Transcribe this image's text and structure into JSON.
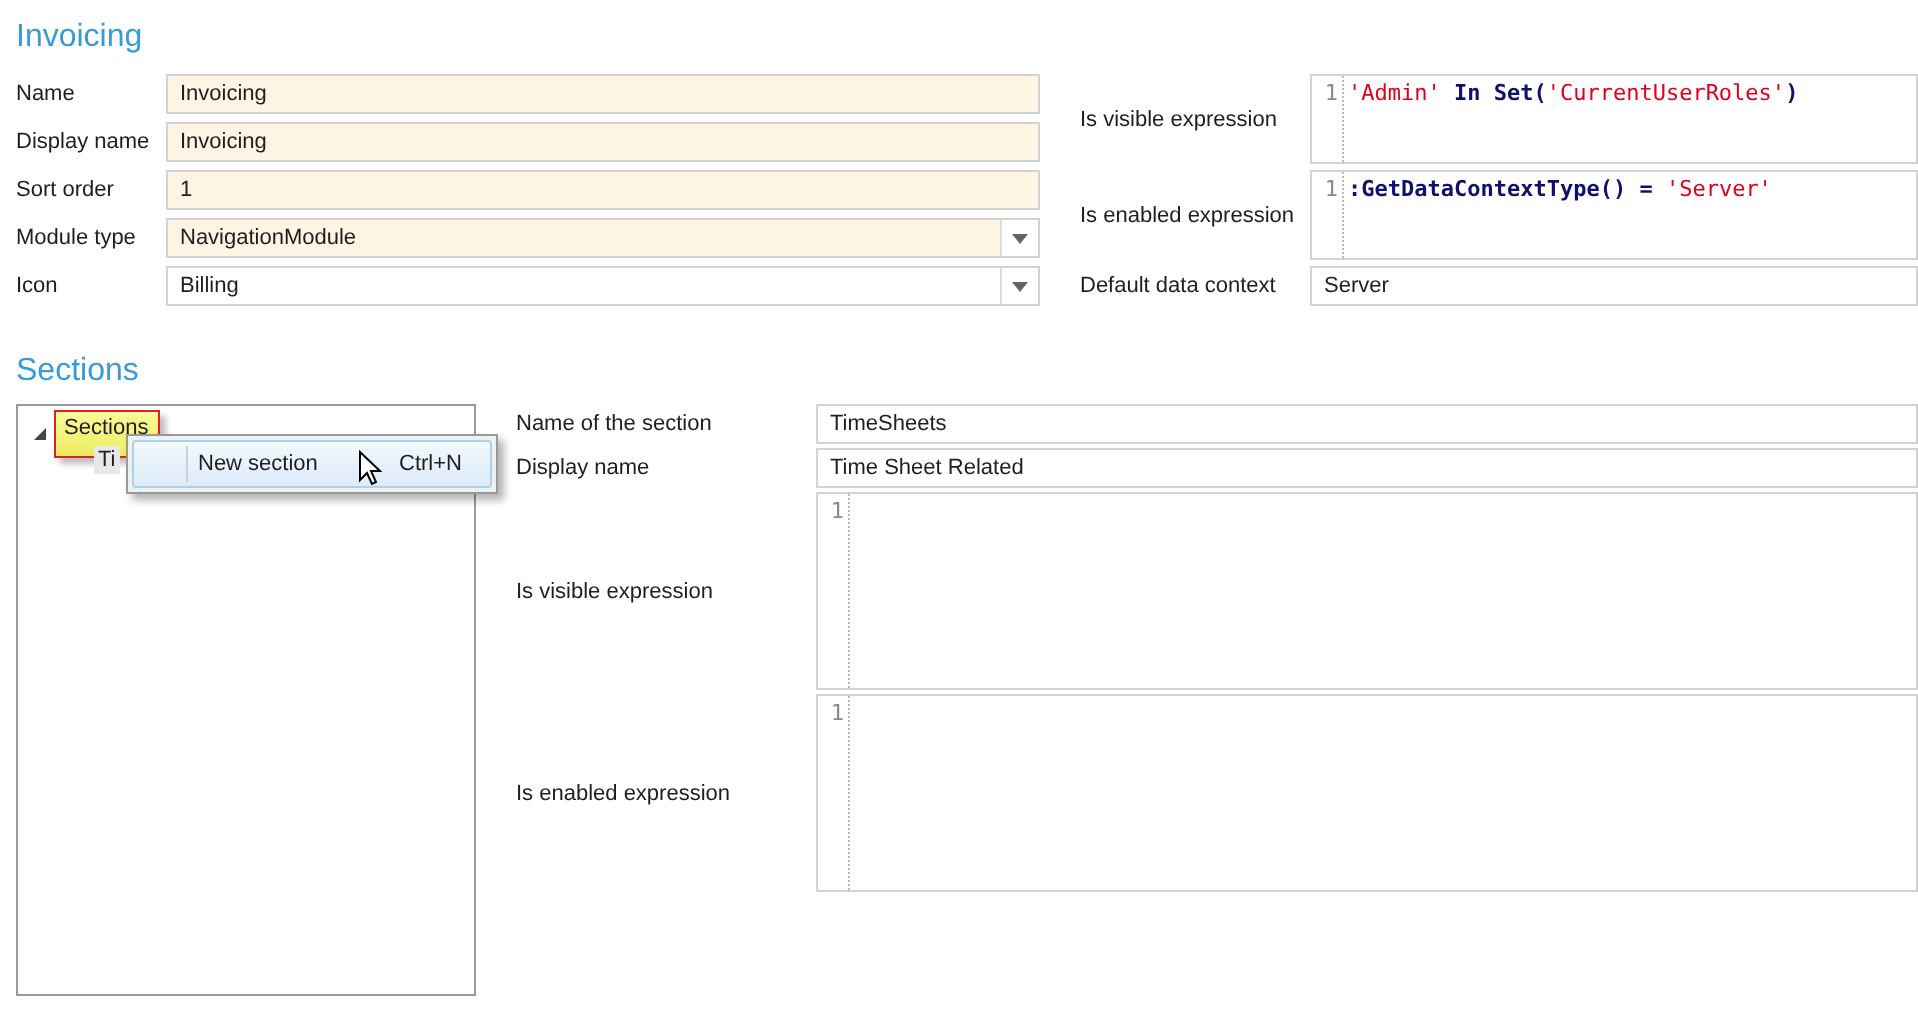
{
  "module": {
    "title": "Invoicing",
    "fields": [
      {
        "label": "Name",
        "value": "Invoicing",
        "kind": "text",
        "required": true
      },
      {
        "label": "Display name",
        "value": "Invoicing",
        "kind": "text",
        "required": true
      },
      {
        "label": "Sort order",
        "value": "1",
        "kind": "text",
        "required": true
      },
      {
        "label": "Module type",
        "value": "NavigationModule",
        "kind": "dropdown",
        "required": true
      },
      {
        "label": "Icon",
        "value": "Billing",
        "kind": "dropdown",
        "required": false
      }
    ],
    "side_fields": [
      {
        "label": "Is visible expression",
        "kind": "code",
        "lines": [
          {
            "number": "1",
            "tokens": [
              {
                "text": "'Admin'",
                "kind": "string"
              },
              {
                "text": " In Set(",
                "kind": "keyword"
              },
              {
                "text": "'CurrentUserRoles'",
                "kind": "string"
              },
              {
                "text": ")",
                "kind": "keyword"
              }
            ]
          }
        ]
      },
      {
        "label": "Is enabled expression",
        "kind": "code",
        "lines": [
          {
            "number": "1",
            "tokens": [
              {
                "text": ":GetDataContextType() = ",
                "kind": "keyword"
              },
              {
                "text": "'Server'",
                "kind": "string"
              }
            ]
          }
        ]
      },
      {
        "label": "Default data context",
        "kind": "text",
        "value": "Server"
      }
    ]
  },
  "sections": {
    "title": "Sections",
    "tree": {
      "label": "Sections",
      "expanded": true,
      "highlighted": true,
      "children": [
        {
          "label": "Ti"
        }
      ]
    },
    "context_menu": {
      "items": [
        {
          "label": "New section",
          "shortcut": "Ctrl+N"
        }
      ]
    },
    "fields": [
      {
        "label": "Name of the section",
        "kind": "text",
        "value": "TimeSheets"
      },
      {
        "label": "Display name",
        "kind": "text",
        "value": "Time Sheet Related"
      },
      {
        "label": "Is visible expression",
        "kind": "code",
        "lines": [
          {
            "number": "1"
          }
        ]
      },
      {
        "label": "Is enabled expression",
        "kind": "code",
        "lines": [
          {
            "number": "1"
          }
        ]
      }
    ]
  }
}
